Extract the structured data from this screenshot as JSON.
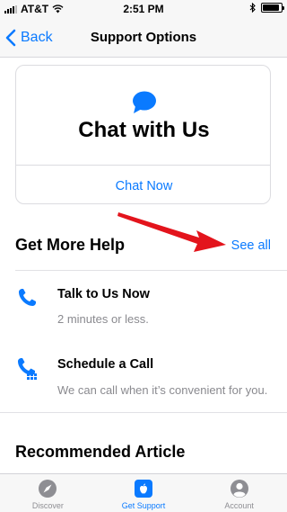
{
  "status_bar": {
    "carrier": "AT&T",
    "time": "2:51 PM",
    "battery_level": 0.9
  },
  "nav": {
    "back_label": "Back",
    "title": "Support Options"
  },
  "chat_card": {
    "icon": "chat-bubble-icon",
    "title": "Chat with Us",
    "action_label": "Chat Now"
  },
  "get_more_help": {
    "title": "Get More Help",
    "see_all_label": "See all",
    "items": [
      {
        "icon": "phone-icon",
        "title": "Talk to Us Now",
        "subtitle": "2 minutes or less."
      },
      {
        "icon": "phone-calendar-icon",
        "title": "Schedule a Call",
        "subtitle": "We can call when it’s convenient for you."
      }
    ]
  },
  "recommended": {
    "title": "Recommended Article"
  },
  "tab_bar": {
    "tabs": [
      {
        "label": "Discover",
        "icon": "compass-icon",
        "active": false
      },
      {
        "label": "Get Support",
        "icon": "apple-icon",
        "active": true
      },
      {
        "label": "Account",
        "icon": "person-icon",
        "active": false
      }
    ]
  },
  "colors": {
    "accent": "#0a7aff",
    "annotation_arrow": "#e3141c"
  }
}
